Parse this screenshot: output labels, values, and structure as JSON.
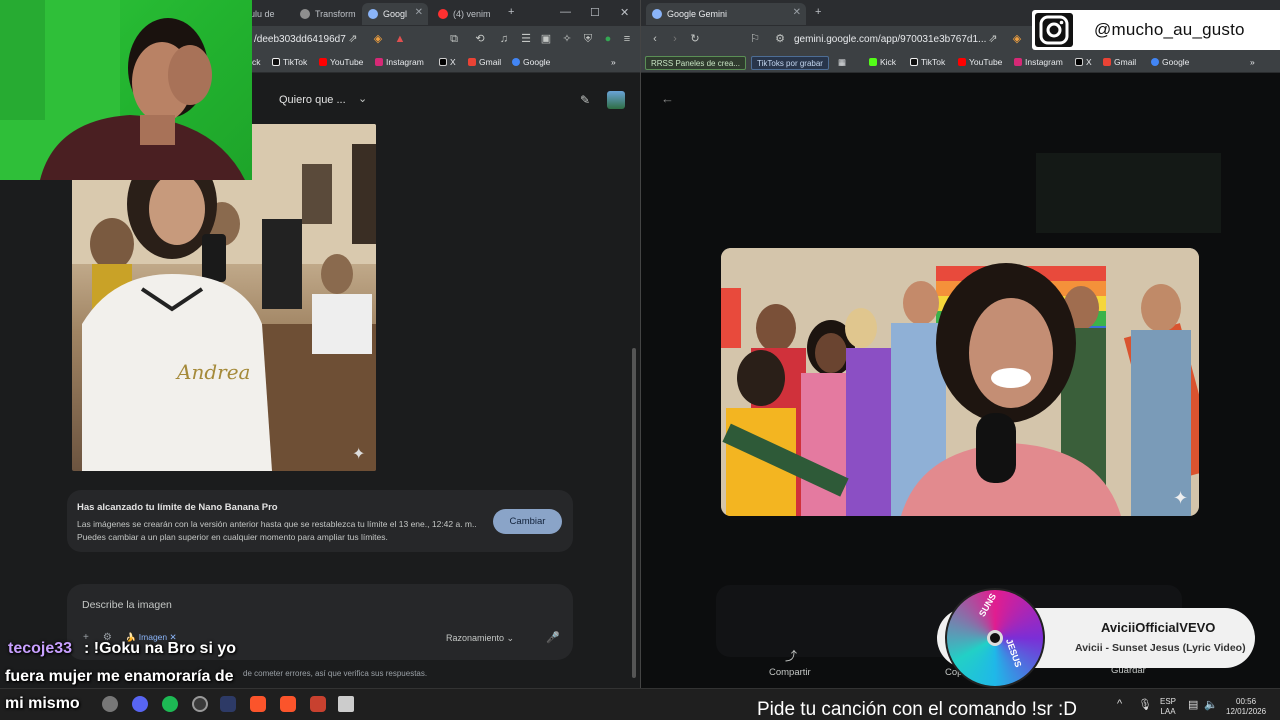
{
  "left_browser": {
    "tabs": [
      {
        "label": "ulu de"
      },
      {
        "label": "Transform"
      },
      {
        "label": "Googl"
      },
      {
        "label": "(4) venim"
      }
    ],
    "url": "/deeb303dd64196d7",
    "bookmarks": [
      "ck",
      "TikTok",
      "YouTube",
      "Instagram",
      "X",
      "Gmail",
      "Google"
    ],
    "gemini": {
      "header_title": "Quiero que ...",
      "limit_title": "Has alcanzado tu límite de Nano Banana Pro",
      "limit_body": "Las imágenes se crearán con la versión anterior hasta que se restablezca tu límite el 13 ene., 12:42 a. m.. Puedes cambiar a un plan superior en cualquier momento para ampliar tus límites.",
      "cambiar_label": "Cambiar",
      "prompt_placeholder": "Describe la imagen",
      "image_chip": "Imagen",
      "reasoning_label": "Razonamiento",
      "disclaimer": "de cometer errores, así que verifica sus respuestas."
    }
  },
  "right_browser": {
    "tab_label": "Google Gemini",
    "url": "gemini.google.com/app/970031e3b767d1...",
    "bookmarks_boxed": [
      "RRSS Paneles de crea...",
      "TikToks por grabar"
    ],
    "bookmarks": [
      "Kick",
      "TikTok",
      "YouTube",
      "Instagram",
      "X",
      "Gmail",
      "Google"
    ],
    "actions": {
      "share": "Compartir",
      "copy": "Cop",
      "save": "Guardar"
    }
  },
  "overlay": {
    "instagram_handle": "@mucho_au_gusto",
    "chat": {
      "user": "tecoje33",
      "line1": ": !Goku na Bro si yo",
      "line2": "fuera mujer me enamoraría de",
      "line3": "mi mismo"
    },
    "music": {
      "channel": "AviciiOfficialVEVO",
      "title": "Avicii - Sunset Jesus (Lyric Video)",
      "disc_text_top": "SUNS",
      "disc_text_bottom": "JESUS"
    },
    "song_request": "Pide tu canción con el comando !sr :D"
  },
  "taskbar": {
    "lang_top": "ESP",
    "lang_bottom": "LAA",
    "time": "00:56",
    "date": "12/01/2026"
  }
}
